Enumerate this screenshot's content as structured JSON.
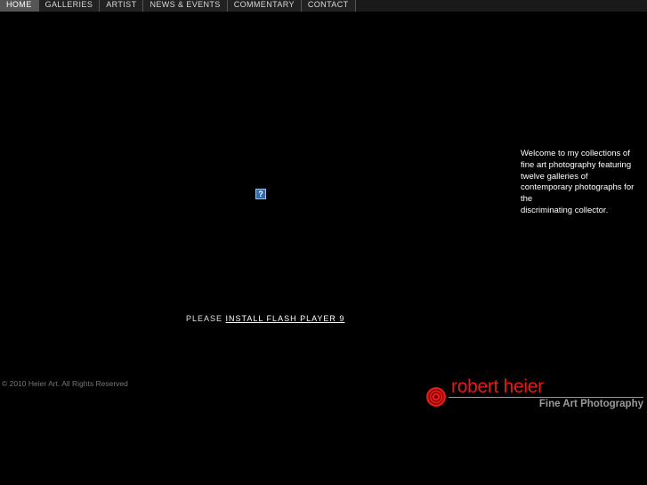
{
  "nav": {
    "items": [
      {
        "label": "HOME",
        "active": true
      },
      {
        "label": "GALLERIES",
        "active": false
      },
      {
        "label": "ARTIST",
        "active": false
      },
      {
        "label": "NEWS & EVENTS",
        "active": false
      },
      {
        "label": "COMMENTARY",
        "active": false
      },
      {
        "label": "CONTACT",
        "active": false
      }
    ]
  },
  "flash": {
    "icon": "missing-plugin-icon",
    "icon_glyph": "?",
    "notice_prefix": "PLEASE",
    "link_label": "INSTALL FLASH PLAYER 9"
  },
  "welcome": {
    "text": "Welcome to my collections of\nfine art photography featuring\ntwelve galleries of\ncontemporary photographs for\nthe\ndiscriminating collector."
  },
  "footer": {
    "copyright": "© 2010 Heier Art. All Rights Reserved"
  },
  "logo": {
    "name": "robert heier",
    "tagline": "Fine Art Photography",
    "brand_color": "#e31b1b",
    "tagline_color": "#9a9a9a"
  },
  "colors": {
    "background": "#000000",
    "nav_active": "#555555",
    "nav_inactive": "#222222"
  }
}
